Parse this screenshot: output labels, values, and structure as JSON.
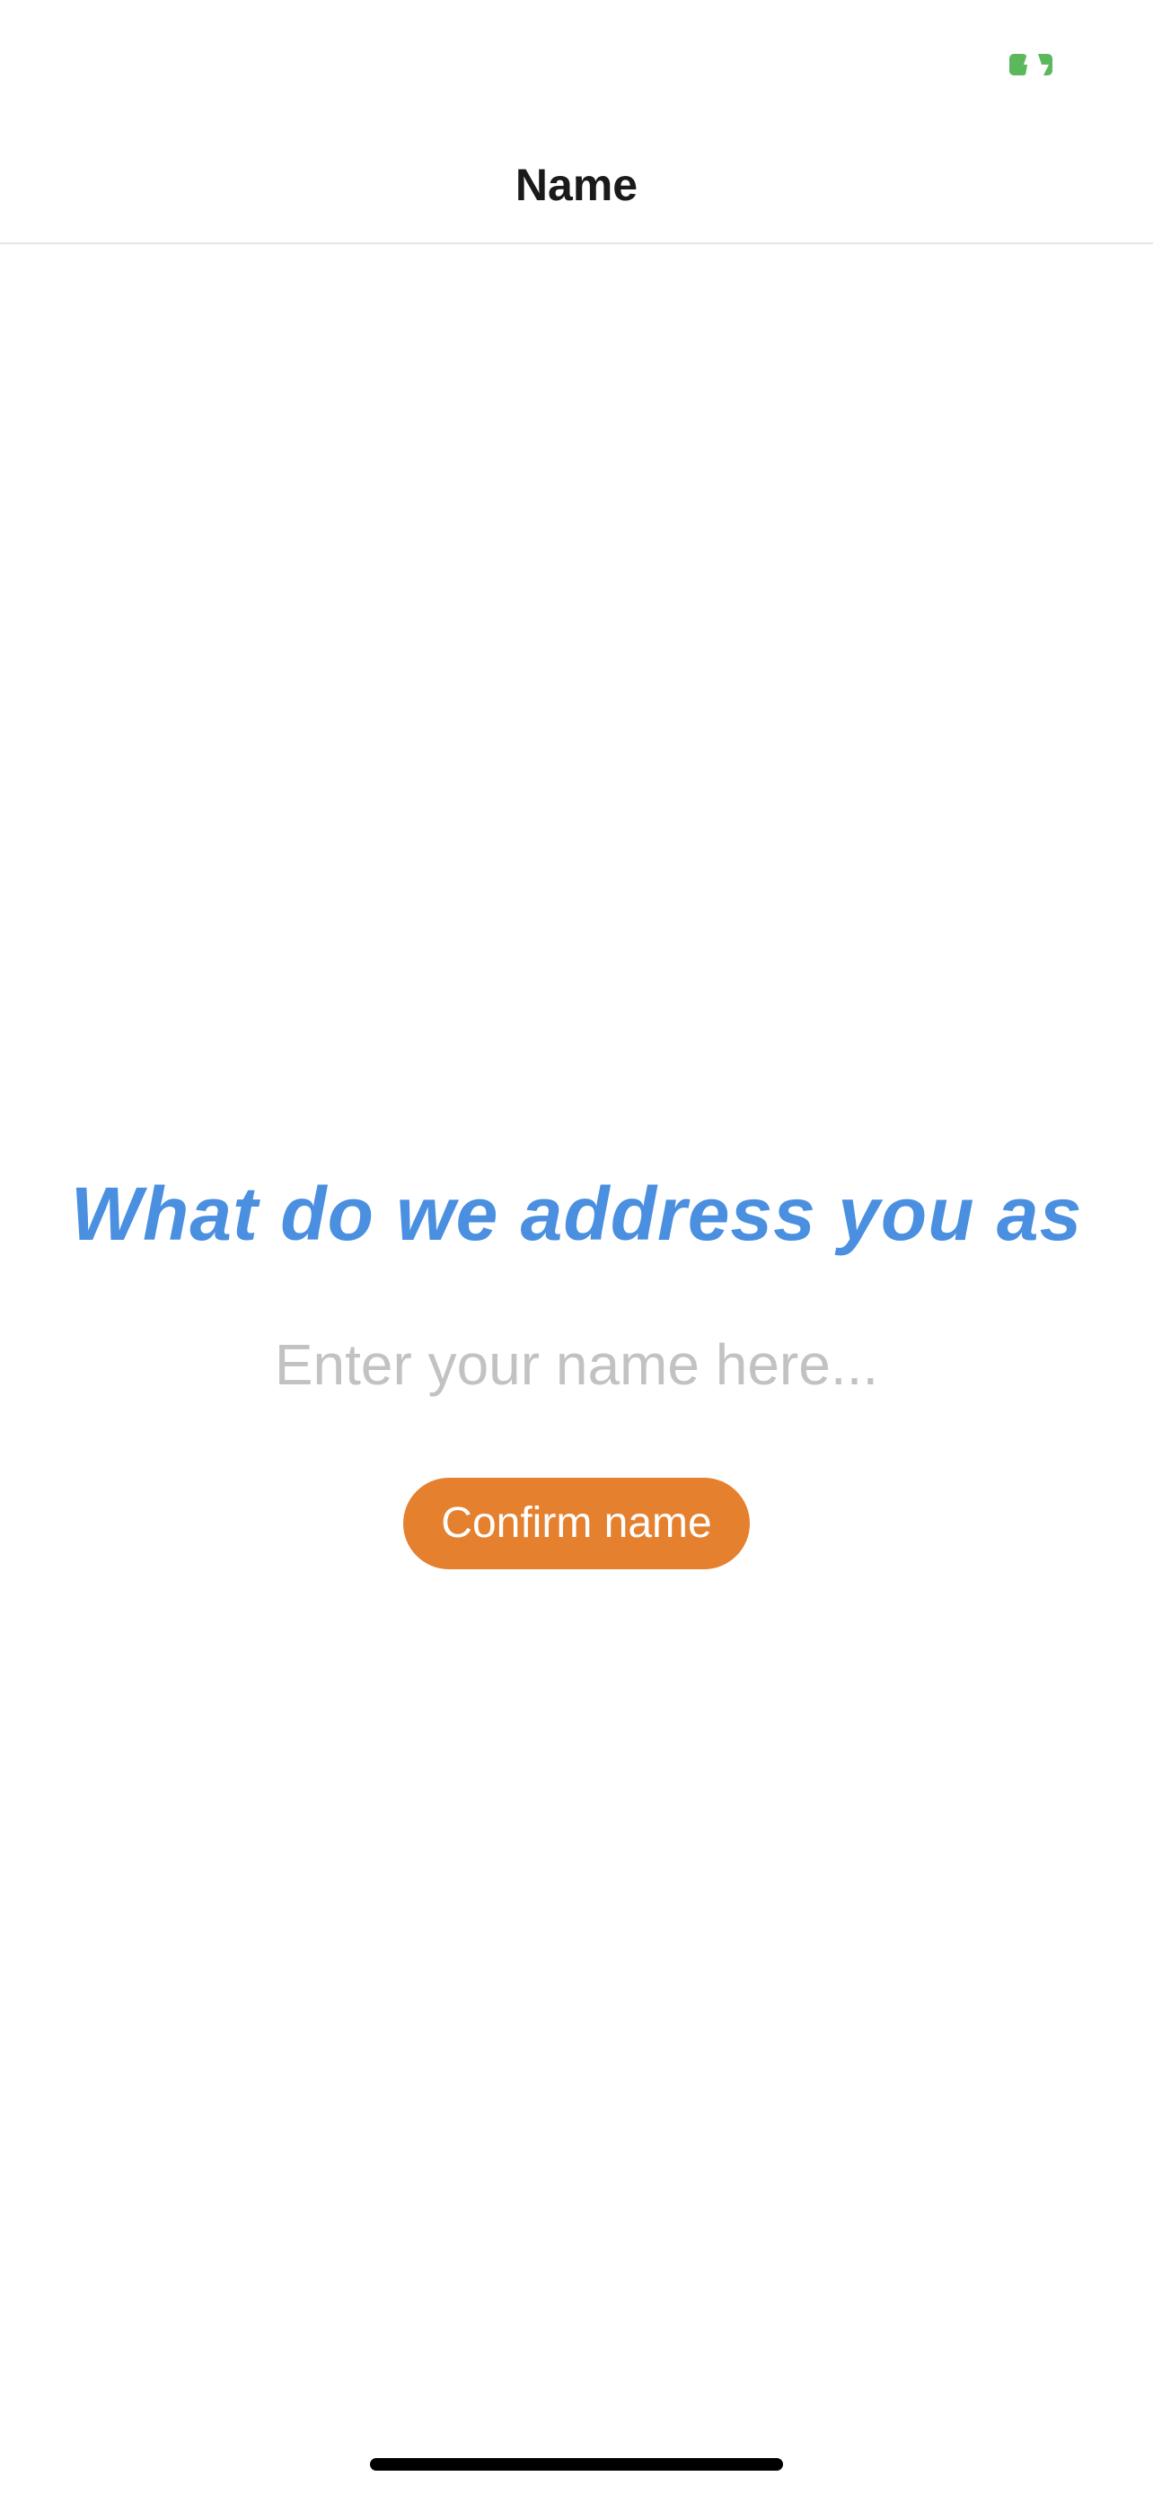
{
  "status_bar": {
    "battery_color": "#5cb85c"
  },
  "nav": {
    "title": "Name"
  },
  "main": {
    "prompt": "What do we address you as",
    "prompt_color": "#4a8fe0",
    "name_input": {
      "value": "",
      "placeholder": "Enter your name here..."
    },
    "confirm_label": "Confirm name",
    "confirm_color": "#e5802f"
  }
}
